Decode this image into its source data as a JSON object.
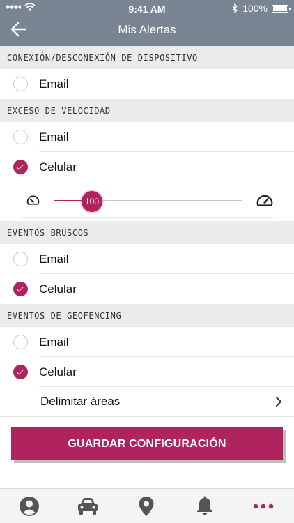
{
  "status_bar": {
    "time": "9:41 AM",
    "battery": "100%"
  },
  "header": {
    "title": "Mis Alertas"
  },
  "colors": {
    "accent": "#b0245e",
    "header_bg": "#7a8593",
    "icon_gray": "#555555"
  },
  "sections": {
    "connection": {
      "title": "CONEXIÓN/DESCONEXIÓN DE DISPOSITIVO",
      "options": [
        {
          "label": "Email",
          "checked": false
        }
      ]
    },
    "speed": {
      "title": "EXCESO DE VELOCIDAD",
      "options": [
        {
          "label": "Email",
          "checked": false
        },
        {
          "label": "Celular",
          "checked": true
        }
      ],
      "slider": {
        "value": "100",
        "fraction": 0.2
      }
    },
    "harsh": {
      "title": "EVENTOS BRUSCOS",
      "options": [
        {
          "label": "Email",
          "checked": false
        },
        {
          "label": "Celular",
          "checked": true
        }
      ]
    },
    "geofencing": {
      "title": "EVENTOS DE GEOFENCING",
      "options": [
        {
          "label": "Email",
          "checked": false
        },
        {
          "label": "Celular",
          "checked": true
        }
      ],
      "link": "Delimitar áreas"
    }
  },
  "save_button": "GUARDAR CONFIGURACIÓN",
  "tabbar": {
    "items": [
      {
        "icon": "user-icon"
      },
      {
        "icon": "car-icon"
      },
      {
        "icon": "location-pin-icon"
      },
      {
        "icon": "bell-icon"
      },
      {
        "icon": "more-dots-icon",
        "active": true
      }
    ]
  }
}
